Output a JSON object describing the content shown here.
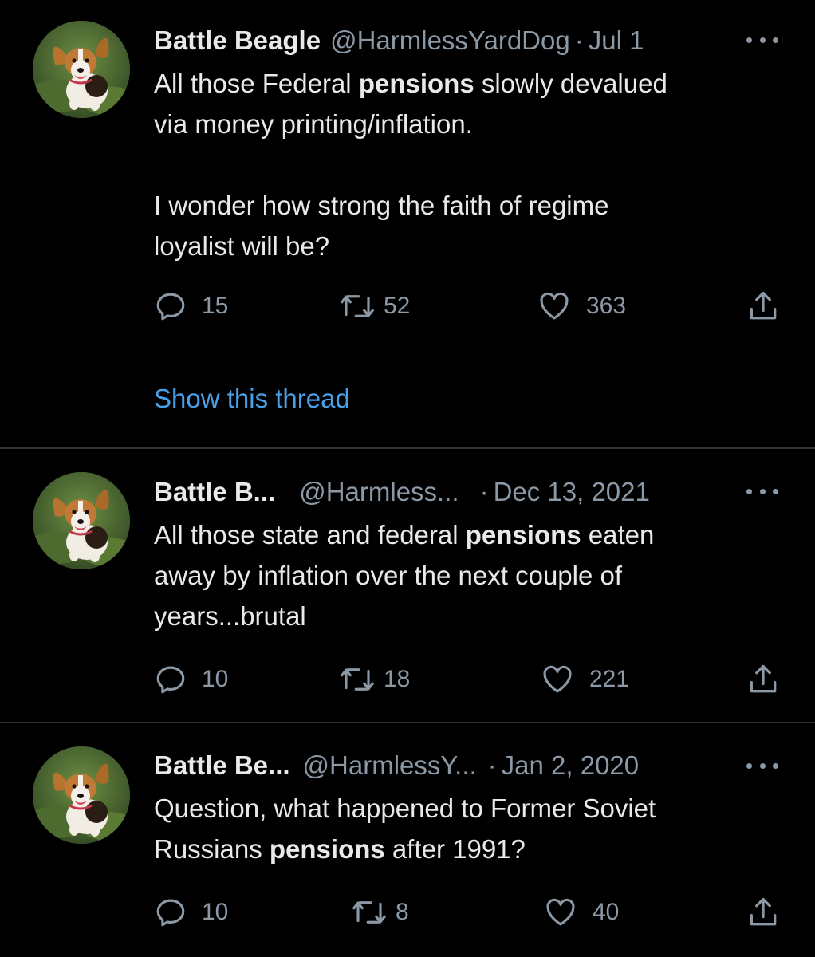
{
  "tweets": [
    {
      "name": "Battle Beagle",
      "handle": "@HarmlessYardDog",
      "separator": "·",
      "date": "Jul 1",
      "body": [
        {
          "text": "All those Federal "
        },
        {
          "text": "pensions",
          "bold": true
        },
        {
          "text": " slowly devalued\nvia money printing/inflation.\n\nI wonder how strong the faith of regime\nloyalist will be?"
        }
      ],
      "replies": "15",
      "retweets": "52",
      "likes": "363",
      "show_thread": "Show this thread"
    },
    {
      "name": "Battle B...",
      "handle": "@Harmless...",
      "separator": "·",
      "date": "Dec 13, 2021",
      "body": [
        {
          "text": "All those state and federal "
        },
        {
          "text": "pensions",
          "bold": true
        },
        {
          "text": " eaten\naway by inflation over the next couple of\nyears...brutal"
        }
      ],
      "replies": "10",
      "retweets": "18",
      "likes": "221"
    },
    {
      "name": "Battle Be...",
      "handle": "@HarmlessY...",
      "separator": "·",
      "date": "Jan 2, 2020",
      "body": [
        {
          "text": "Question, what happened to Former Soviet\nRussians "
        },
        {
          "text": "pensions",
          "bold": true
        },
        {
          "text": " after 1991?"
        }
      ],
      "replies": "10",
      "retweets": "8",
      "likes": "40"
    }
  ],
  "colors": {
    "background": "#000000",
    "text": "#e7e9ea",
    "secondary": "#8b98a5",
    "link": "#4aa0e8",
    "divider": "#2f3336"
  },
  "icons": {
    "reply": "reply-icon",
    "retweet": "retweet-icon",
    "like": "heart-icon",
    "share": "share-icon",
    "more": "more-options-icon",
    "avatar": "beagle-avatar"
  }
}
